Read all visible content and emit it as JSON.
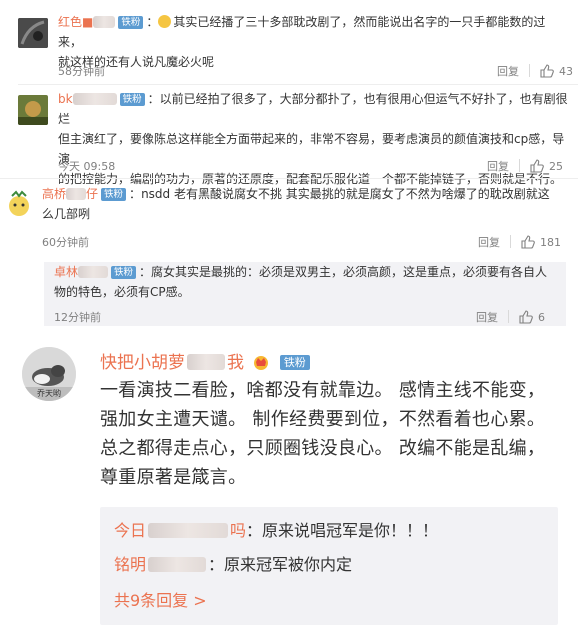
{
  "comments": [
    {
      "user": "红色■",
      "badge": "铁粉",
      "text_line1": "其实已经播了三十多部耽改剧了，然而能说出名字的一只手都能数的过来，",
      "text_line2": "就这样的还有人说凡魔必火呢",
      "time": "58分钟前",
      "reply": "回复",
      "likes": "43"
    },
    {
      "user": "bk",
      "badge": "铁粉",
      "text_line1": "以前已经拍了很多了，大部分都扑了，也有很用心但运气不好扑了，也有剧很烂",
      "text_line2": "但主演红了，要像陈总这样能全方面带起来的，非常不容易，要考虑演员的颜值演技和cp感，导演",
      "text_line3": "的把控能力，编剧的功力，原著的还原度，配套配乐服化道一个都不能掉链子，否则就是不行。",
      "time": "今天 09:58",
      "reply": "回复",
      "likes": "25"
    },
    {
      "user": "高桥",
      "user_tail": "仔",
      "badge": "铁粉",
      "text_line1": "nsdd  老有黑酸说腐女不挑  其实最挑的就是腐女了不然为啥爆了的耽改剧就这",
      "text_line2": "么几部咧",
      "time": "60分钟前",
      "reply": "回复",
      "likes": "181"
    },
    {
      "user": "卓林",
      "badge": "铁粉",
      "text_line1": "腐女其实是最挑的：必须是双男主，必须高颜，这是重点，必须要有各自人",
      "text_line2": "物的特色，必须有CP感。",
      "time": "12分钟前",
      "reply": "回复",
      "likes": "6"
    }
  ],
  "featured": {
    "user": "快把小胡萝",
    "user_tail": "我",
    "badge": "铁粉",
    "avatar_caption": "乔天哟",
    "text": "一看演技二看脸，啥都没有就靠边。 感情主线不能变，强加女主遭天谴。 制作经费要到位，不然看着也心累。 总之都得走点心，只顾圈钱没良心。 改编不能是乱编，尊重原著是箴言。",
    "replies": [
      {
        "user": "今日",
        "user_tail": "吗",
        "text": "原来说唱冠军是你！！！"
      },
      {
        "user": "铭明",
        "user_tail": "",
        "text": "原来冠军被你内定"
      }
    ],
    "more": "共9条回复 >"
  },
  "colors": {
    "username": "#eb7350",
    "badge": "#5c9bd1",
    "meta": "#808080",
    "reply_bg": "#f2f2f5"
  },
  "icons": [
    "avatar",
    "emoji-icon",
    "thumbs-up-icon",
    "crown-icon"
  ]
}
